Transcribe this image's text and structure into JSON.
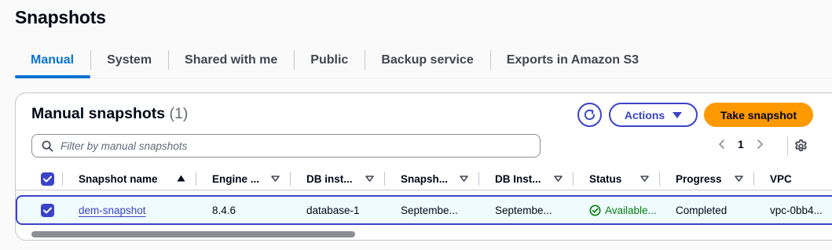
{
  "page": {
    "title": "Snapshots"
  },
  "tabs": [
    {
      "label": "Manual",
      "active": true
    },
    {
      "label": "System",
      "active": false
    },
    {
      "label": "Shared with me",
      "active": false
    },
    {
      "label": "Public",
      "active": false
    },
    {
      "label": "Backup service",
      "active": false
    },
    {
      "label": "Exports in Amazon S3",
      "active": false
    }
  ],
  "panel": {
    "title": "Manual snapshots",
    "count": "(1)",
    "actions_label": "Actions",
    "take_snapshot_label": "Take snapshot",
    "filter_placeholder": "Filter by manual snapshots",
    "page_number": "1"
  },
  "table": {
    "columns": [
      "Snapshot name",
      "Engine ...",
      "DB inst...",
      "Snapsh...",
      "DB Inst...",
      "Status",
      "Progress",
      "VPC"
    ],
    "rows": [
      {
        "selected": true,
        "snapshot_name": "dem-snapshot",
        "engine": "8.4.6",
        "db_instance": "database-1",
        "snapshot_time": "Septembe...",
        "db_instance_created": "Septembe...",
        "status": "Available...",
        "progress": "Completed",
        "vpc": "vpc-0bb4..."
      }
    ]
  },
  "colors": {
    "primary": "#3a43c8",
    "tab_active": "#0972d3",
    "cta": "#ff9900",
    "success": "#037f0c"
  },
  "icons": [
    "refresh-icon",
    "caret-down-icon",
    "search-icon",
    "chevron-left-icon",
    "chevron-right-icon",
    "gear-icon",
    "sort-asc-icon",
    "sort-desc-icon",
    "checkmark-icon",
    "status-success-icon"
  ]
}
